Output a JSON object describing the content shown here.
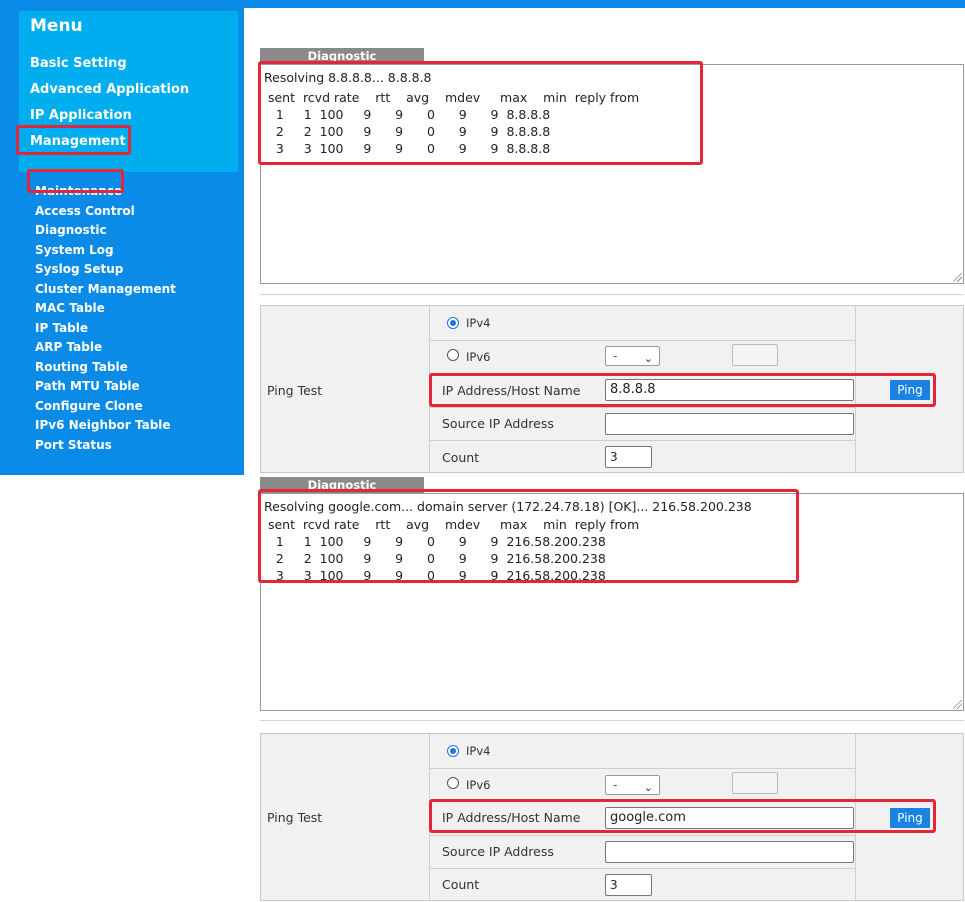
{
  "menu": {
    "title": "Menu",
    "items": [
      "Basic Setting",
      "Advanced Application",
      "IP Application",
      "Management"
    ],
    "subitems": [
      "Maintenance",
      "Access Control",
      "Diagnostic",
      "System Log",
      "Syslog Setup",
      "Cluster Management",
      "MAC Table",
      "IP Table",
      "ARP Table",
      "Routing Table",
      "Path MTU Table",
      "Configure Clone",
      "IPv6 Neighbor Table",
      "Port Status"
    ]
  },
  "diag1": {
    "label": "Diagnostic",
    "lines": [
      "Resolving 8.8.8.8... 8.8.8.8",
      " sent  rcvd rate    rtt    avg    mdev     max    min  reply from",
      "   1     1  100     9      9      0      9      9  8.8.8.8",
      "   2     2  100     9      9      0      9      9  8.8.8.8",
      "   3     3  100     9      9      0      9      9  8.8.8.8"
    ]
  },
  "ping1": {
    "label": "Ping Test",
    "ipv4": "IPv4",
    "ipv6": "IPv6",
    "select_value": "-",
    "ip_label": "IP Address/Host Name",
    "ip_value": "8.8.8.8",
    "source_label": "Source IP Address",
    "source_value": "",
    "count_label": "Count",
    "count_value": "3",
    "button": "Ping"
  },
  "diag2": {
    "label": "Diagnostic",
    "lines": [
      "Resolving google.com... domain server (172.24.78.18) [OK]... 216.58.200.238",
      " sent  rcvd rate    rtt    avg    mdev     max    min  reply from",
      "   1     1  100     9      9      0      9      9  216.58.200.238",
      "   2     2  100     9      9      0      9      9  216.58.200.238",
      "   3     3  100     9      9      0      9      9  216.58.200.238"
    ]
  },
  "ping2": {
    "label": "Ping Test",
    "ipv4": "IPv4",
    "ipv6": "IPv6",
    "select_value": "-",
    "ip_label": "IP Address/Host Name",
    "ip_value": "google.com",
    "source_label": "Source IP Address",
    "source_value": "",
    "count_label": "Count",
    "count_value": "3",
    "button": "Ping"
  }
}
